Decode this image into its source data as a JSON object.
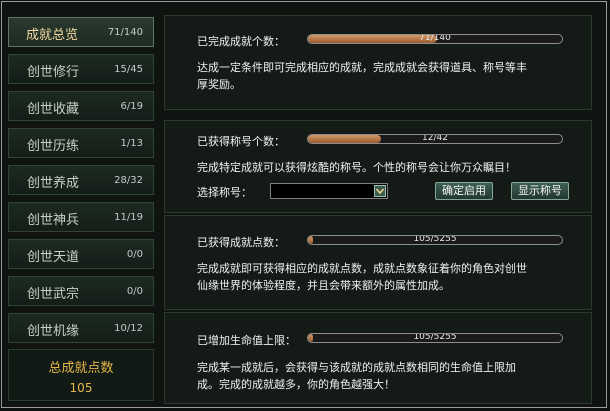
{
  "sidebar": {
    "items": [
      {
        "label": "成就总览",
        "count": "71/140",
        "active": true
      },
      {
        "label": "创世修行",
        "count": "15/45"
      },
      {
        "label": "创世收藏",
        "count": "6/19"
      },
      {
        "label": "创世历练",
        "count": "1/13"
      },
      {
        "label": "创世养成",
        "count": "28/32"
      },
      {
        "label": "创世神兵",
        "count": "11/19"
      },
      {
        "label": "创世天道",
        "count": "0/0"
      },
      {
        "label": "创世武宗",
        "count": "0/0"
      },
      {
        "label": "创世机缘",
        "count": "10/12"
      }
    ],
    "total_label": "总成就点数",
    "total_value": "105"
  },
  "panels": {
    "achievements": {
      "title": "已完成成就个数：",
      "progress_text": "71/140",
      "progress_fraction": 0.507,
      "desc_line1": "达成一定条件即可完成相应的成就，完成成就会获得道具、称号等丰",
      "desc_line2": "厚奖励。"
    },
    "titles": {
      "title": "已获得称号个数：",
      "progress_text": "12/42",
      "progress_fraction": 0.286,
      "desc": "完成特定成就可以获得炫酷的称号。个性的称号会让你万众瞩目！",
      "select_label": "选择称号：",
      "select_value": "",
      "confirm_button": "确定启用",
      "show_button": "显示称号"
    },
    "points": {
      "title": "已获得成就点数：",
      "progress_text": "105/5255",
      "progress_fraction": 0.02,
      "desc_line1": "完成成就即可获得相应的成就点数，成就点数象征着你的角色对创世",
      "desc_line2": "仙缘世界的体验程度，并且会带来额外的属性加成。"
    },
    "hp": {
      "title": "已增加生命值上限：",
      "progress_text": "105/5255",
      "progress_fraction": 0.02,
      "desc_line1": "完成某一成就后，会获得与该成就的成就点数相同的生命值上限加",
      "desc_line2": "成。完成的成就越多，你的角色越强大！"
    }
  }
}
